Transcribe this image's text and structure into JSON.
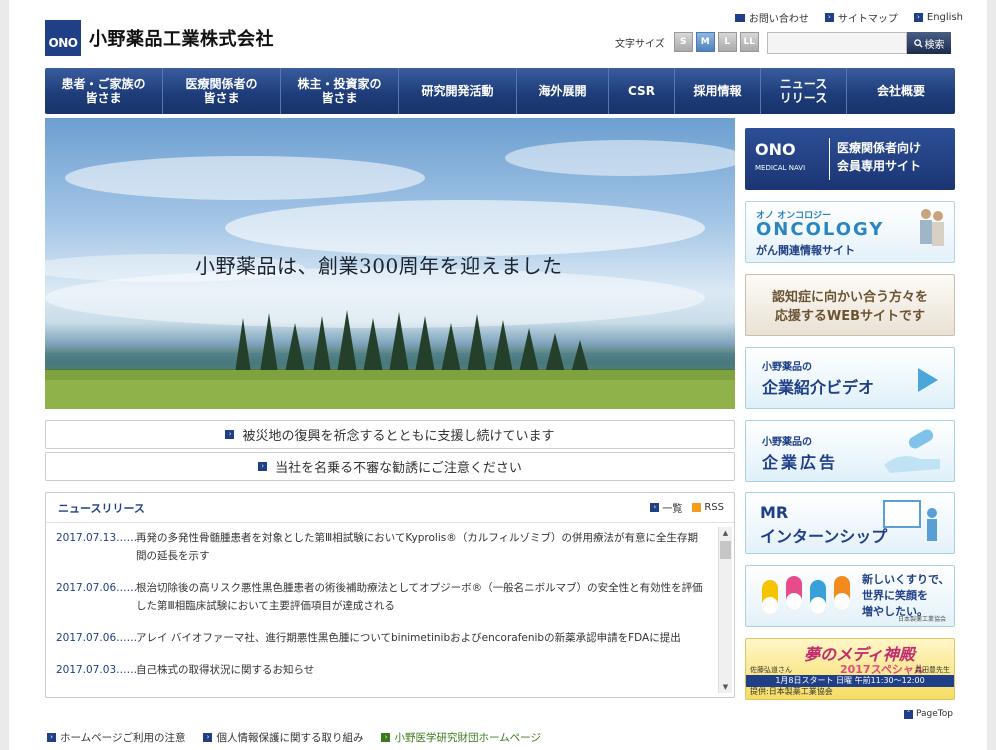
{
  "header": {
    "logo_mark": "ONO",
    "company_name": "小野薬品工業株式会社",
    "top_links": [
      "お問い合わせ",
      "サイトマップ",
      "English"
    ],
    "text_size_label": "文字サイズ",
    "text_sizes": [
      "S",
      "M",
      "L",
      "LL"
    ],
    "text_size_selected": "M",
    "search_placeholder": "",
    "search_button": "検索"
  },
  "nav": {
    "items": [
      "患者・ご家族の\n皆さま",
      "医療関係者の\n皆さま",
      "株主・投資家の\n皆さま",
      "研究開発活動",
      "海外展開",
      "CSR",
      "採用情報",
      "ニュース\nリリース",
      "会社概要"
    ]
  },
  "hero": {
    "caption": "小野薬品は、創業300周年を迎えました"
  },
  "notices": [
    "被災地の復興を祈念するとともに支援し続けています",
    "当社を名乗る不審な勧誘にご注意ください"
  ],
  "news": {
    "title": "ニュースリリース",
    "list_link": "一覧",
    "rss_link": "RSS",
    "items": [
      {
        "date": "2017.07.13……",
        "text": "再発の多発性骨髄腫患者を対象とした第Ⅲ相試験においてKyprolis®（カルフィルゾミブ）の併用療法が有意に全生存期間の延長を示す"
      },
      {
        "date": "2017.07.06……",
        "text": "根治切除後の高リスク悪性黒色腫患者の術後補助療法としてオプジーボ®（一般名ニボルマブ）の安全性と有効性を評価した第Ⅲ相臨床試験において主要評価項目が達成される"
      },
      {
        "date": "2017.07.06……",
        "text": "アレイ バイオファーマ社、進行期悪性黒色腫についてbinimetinibおよびencorafenibの新薬承認申請をFDAに提出"
      },
      {
        "date": "2017.07.03……",
        "text": "自己株式の取得状況に関するお知らせ"
      }
    ]
  },
  "sidebar": {
    "medical_navi": {
      "logo": "ONO",
      "logo_sub": "MEDICAL NAVI",
      "text": "医療関係者向け\n会員専用サイト"
    },
    "oncology": {
      "small": "オノ オンコロジー",
      "logo": "ONCOLOGY",
      "sub": "がん関連情報サイト"
    },
    "dementia": {
      "text": "認知症に向かい合う方々を\n応援するWEBサイトです"
    },
    "video": {
      "small": "小野薬品の",
      "large": "企業紹介ビデオ"
    },
    "ad": {
      "small": "小野薬品の",
      "large": "企業広告"
    },
    "internship": {
      "line1": "MR",
      "line2": "インターンシップ"
    },
    "jpma": {
      "text": "新しいくすりで、\n世界に笑顔を\n増やしたい。",
      "footer": "日本製薬工業協会"
    },
    "medi": {
      "title": "夢のメディ神殿",
      "subtitle": "2017スペシャル",
      "date": "1月8日スタート 日曜 午前11:30～12:00",
      "name1": "佐藤弘道さん",
      "name2": "森田豊先生",
      "credit": "提供:日本製薬工業協会"
    }
  },
  "pagetop": "PageTop",
  "footer": {
    "links": [
      "ホームページご利用の注意",
      "個人情報保護に関する取り組み",
      "小野医学研究財団ホームページ"
    ]
  },
  "colors": {
    "brand": "#1f3f87",
    "green": "#3a7a1d"
  }
}
